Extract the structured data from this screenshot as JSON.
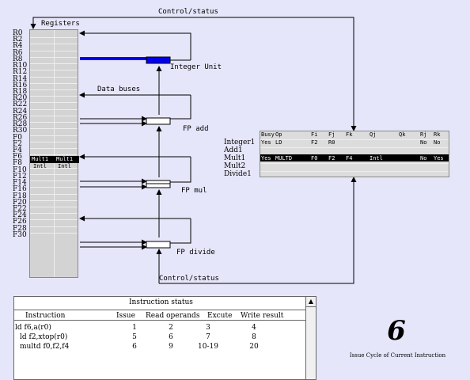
{
  "registers_title": "Registers",
  "register_names": [
    "R0",
    "R2",
    "R4",
    "R6",
    "R8",
    "R10",
    "R12",
    "R14",
    "R16",
    "R18",
    "R20",
    "R22",
    "R24",
    "R26",
    "R28",
    "R30",
    "F0",
    "F2",
    "F4",
    "F6",
    "F8",
    "F10",
    "F12",
    "F14",
    "F16",
    "F18",
    "F20",
    "F22",
    "F24",
    "F26",
    "F28",
    "F30"
  ],
  "register_status": {
    "F0": [
      "Mult1",
      "Mult1"
    ],
    "F2": [
      "Intl",
      "Intl"
    ]
  },
  "labels": {
    "control_status_top": "Control/status",
    "control_status_bottom": "Control/status",
    "data_buses": "Data buses",
    "integer_unit": "Integer Unit",
    "fp_add": "FP add",
    "fp_mul": "FP mul",
    "fp_divide": "FP divide"
  },
  "functional_units": {
    "headers": [
      "Busy",
      "Op",
      "Fi",
      "Fj",
      "Fk",
      "Qj",
      "Qk",
      "Rj",
      "Rk"
    ],
    "rows": [
      {
        "name": "Integer1",
        "busy": "Yes",
        "op": "LD",
        "fi": "F2",
        "fj": "R0",
        "fk": "",
        "qj": "",
        "qk": "",
        "rj": "No",
        "rk": "No",
        "highlight": false
      },
      {
        "name": "Add1",
        "busy": "",
        "op": "",
        "fi": "",
        "fj": "",
        "fk": "",
        "qj": "",
        "qk": "",
        "rj": "",
        "rk": "",
        "highlight": false
      },
      {
        "name": "Mult1",
        "busy": "Yes",
        "op": "MULTD",
        "fi": "F0",
        "fj": "F2",
        "fk": "F4",
        "qj": "Intl",
        "qk": "",
        "rj": "No",
        "rk": "Yes",
        "highlight": true
      },
      {
        "name": "Mult2",
        "busy": "",
        "op": "",
        "fi": "",
        "fj": "",
        "fk": "",
        "qj": "",
        "qk": "",
        "rj": "",
        "rk": "",
        "highlight": false
      },
      {
        "name": "Divide1",
        "busy": "",
        "op": "",
        "fi": "",
        "fj": "",
        "fk": "",
        "qj": "",
        "qk": "",
        "rj": "",
        "rk": "",
        "highlight": false
      }
    ]
  },
  "instruction_status": {
    "title": "Instruction status",
    "headers": [
      "Instruction",
      "Issue",
      "Read operands",
      "Excute",
      "Write result"
    ],
    "rows": [
      {
        "instruction": "ld f6,a(r0)",
        "issue": "1",
        "read": "2",
        "execute": "3",
        "write": "4"
      },
      {
        "instruction": "ld f2,xtop(r0)",
        "issue": "5",
        "read": "6",
        "execute": "7",
        "write": "8"
      },
      {
        "instruction": "multd f0,f2,f4",
        "issue": "6",
        "read": "9",
        "execute": "10-19",
        "write": "20"
      }
    ]
  },
  "cycle": {
    "value": "6",
    "caption": "Issue Cycle of Current Instruction"
  }
}
